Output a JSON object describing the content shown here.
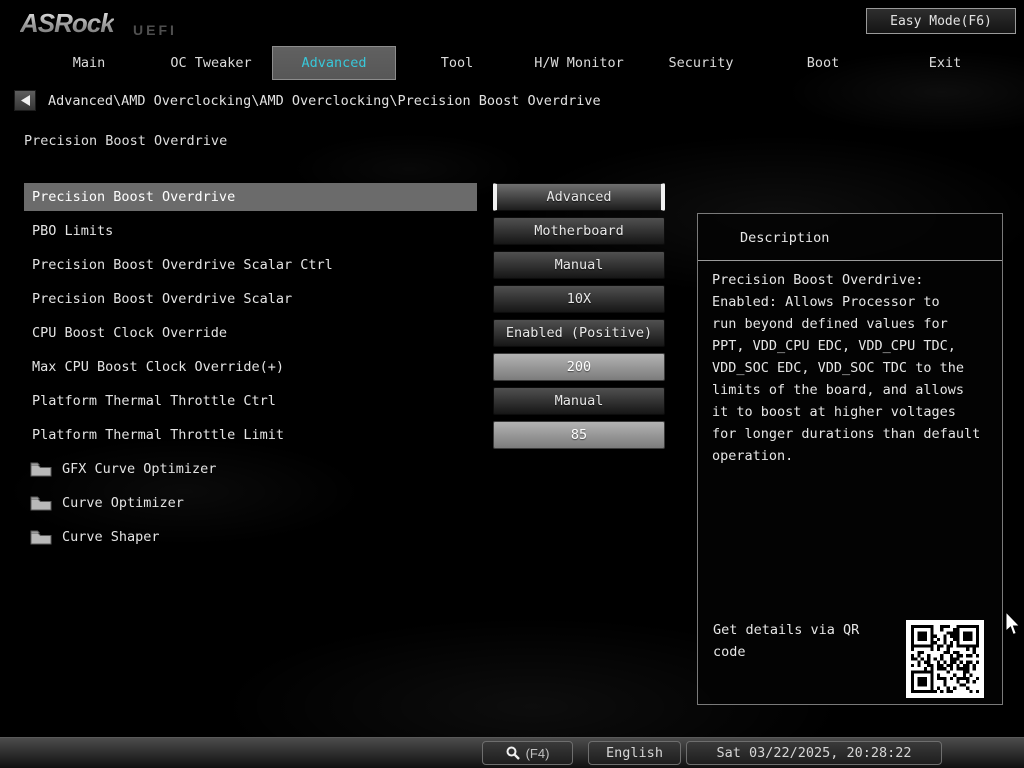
{
  "header": {
    "logo_text": "ASRock",
    "logo_sub": "UEFI",
    "easy_mode_label": "Easy Mode(F6)"
  },
  "nav": {
    "active_tab": "Advanced",
    "tabs": [
      {
        "label": "Main"
      },
      {
        "label": "OC Tweaker"
      },
      {
        "label": "Advanced"
      },
      {
        "label": "Tool"
      },
      {
        "label": "H/W Monitor"
      },
      {
        "label": "Security"
      },
      {
        "label": "Boot"
      },
      {
        "label": "Exit"
      }
    ]
  },
  "breadcrumb": {
    "path": "Advanced\\AMD Overclocking\\AMD Overclocking\\Precision Boost Overdrive"
  },
  "page_title": "Precision Boost Overdrive",
  "settings": {
    "rows": [
      {
        "label": "Precision Boost Overdrive",
        "value": "Advanced"
      },
      {
        "label": "PBO Limits",
        "value": "Motherboard"
      },
      {
        "label": "Precision Boost Overdrive Scalar Ctrl",
        "value": "Manual"
      },
      {
        "label": "Precision Boost Overdrive Scalar",
        "value": "10X"
      },
      {
        "label": "CPU Boost Clock Override",
        "value": "Enabled (Positive)"
      },
      {
        "label": "Max CPU Boost Clock Override(+)",
        "value": "200"
      },
      {
        "label": "Platform Thermal Throttle Ctrl",
        "value": "Manual"
      },
      {
        "label": "Platform Thermal Throttle Limit",
        "value": "85"
      }
    ],
    "folders": [
      {
        "label": "GFX Curve Optimizer"
      },
      {
        "label": "Curve Optimizer"
      },
      {
        "label": "Curve Shaper"
      }
    ]
  },
  "description": {
    "title": "Description",
    "body": "Precision Boost Overdrive:\n  Enabled: Allows Processor to\nrun beyond defined values for\nPPT, VDD_CPU EDC, VDD_CPU TDC,\nVDD_SOC EDC, VDD_SOC TDC to the\nlimits of the board, and allows\nit to boost at higher voltages\nfor longer durations than default\noperation.",
    "qr_label": "Get details via QR code"
  },
  "footer": {
    "search_key": "(F4)",
    "language": "English",
    "datetime": "Sat 03/22/2025, 20:28:22"
  },
  "colors": {
    "accent_cyan": "#38c8da",
    "selected_row_bg": "#6b6b6b"
  }
}
